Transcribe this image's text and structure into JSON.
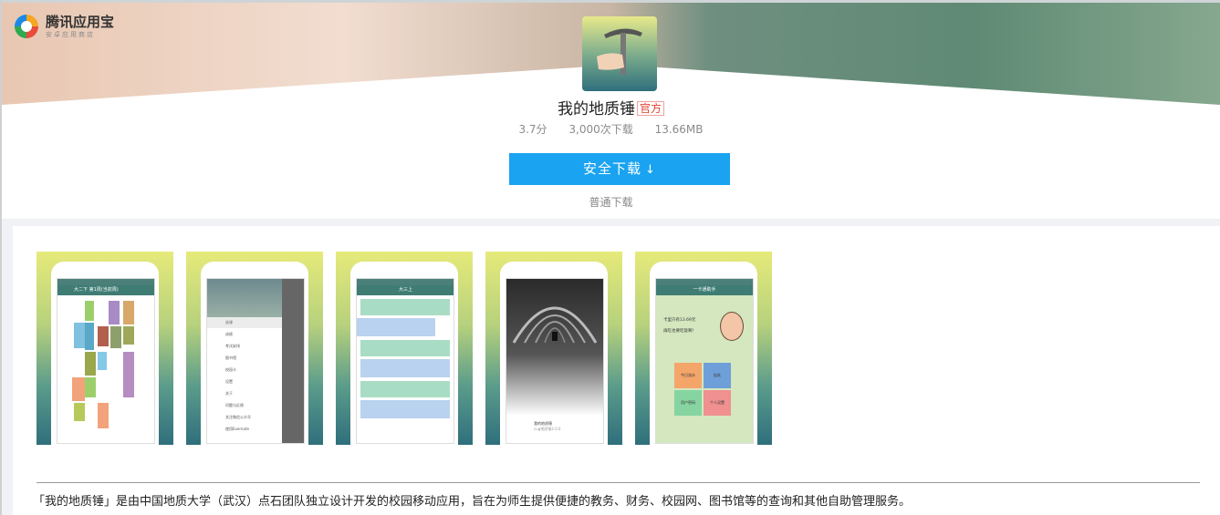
{
  "brand": {
    "title": "腾讯应用宝",
    "subtitle": "安卓应用商店"
  },
  "app": {
    "name": "我的地质锤",
    "official_badge": "官方",
    "rating": "3.7分",
    "downloads": "3,000次下载",
    "size": "13.66MB"
  },
  "actions": {
    "safe_download": "安全下载",
    "normal_download": "普通下载"
  },
  "screenshots": [
    {
      "label": "大二下 第1周(当前周)"
    },
    {
      "label": "侧边菜单"
    },
    {
      "label": "大三上"
    },
    {
      "label": "我的地质锤"
    },
    {
      "label": "一卡通助手"
    }
  ],
  "shot4_caption": {
    "title": "我的地质锤",
    "sub": "cug地质锤2.0.0"
  },
  "shot5": {
    "title": "一卡通助手",
    "balance_line1": "卡里只有13.69元",
    "balance_line2": "再吃也要吃饭啊!",
    "tiles": [
      "今日流水",
      "挂失",
      "用户密码",
      "个人设置"
    ]
  },
  "shot2_menu": [
    "选课",
    "成绩",
    "考试安排",
    "图书馆",
    "校园卡",
    "设置",
    "关于",
    "问题与反馈",
    "关注微信公众号",
    "使用Evernote"
  ],
  "description": "「我的地质锤」是由中国地质大学（武汉）点石团队独立设计开发的校园移动应用，旨在为师生提供便捷的教务、财务、校园网、图书馆等的查询和其他自助管理服务。",
  "colors": {
    "accent": "#1aa3f0",
    "official": "#e2412e",
    "theme_teal": "#3f7d74"
  }
}
